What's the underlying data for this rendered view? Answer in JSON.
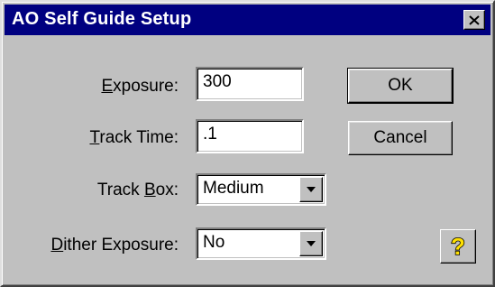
{
  "window": {
    "title": "AO Self Guide Setup"
  },
  "fields": {
    "exposure": {
      "label_pre": "",
      "label_key": "E",
      "label_post": "xposure:",
      "value": "300"
    },
    "track_time": {
      "label_pre": "",
      "label_key": "T",
      "label_post": "rack Time:",
      "value": ".1"
    },
    "track_box": {
      "label_pre": "Track ",
      "label_key": "B",
      "label_post": "ox:",
      "value": "Medium"
    },
    "dither_exposure": {
      "label_pre": "",
      "label_key": "D",
      "label_post": "ither Exposure:",
      "value": "No"
    }
  },
  "buttons": {
    "ok": "OK",
    "cancel": "Cancel",
    "help_glyph": "?"
  },
  "colors": {
    "titlebar": "#000080",
    "face": "#c0c0c0",
    "help_question": "#ffe000"
  },
  "icons": {
    "close": "close-icon",
    "dropdown": "chevron-down-icon",
    "help": "question-mark-icon"
  }
}
